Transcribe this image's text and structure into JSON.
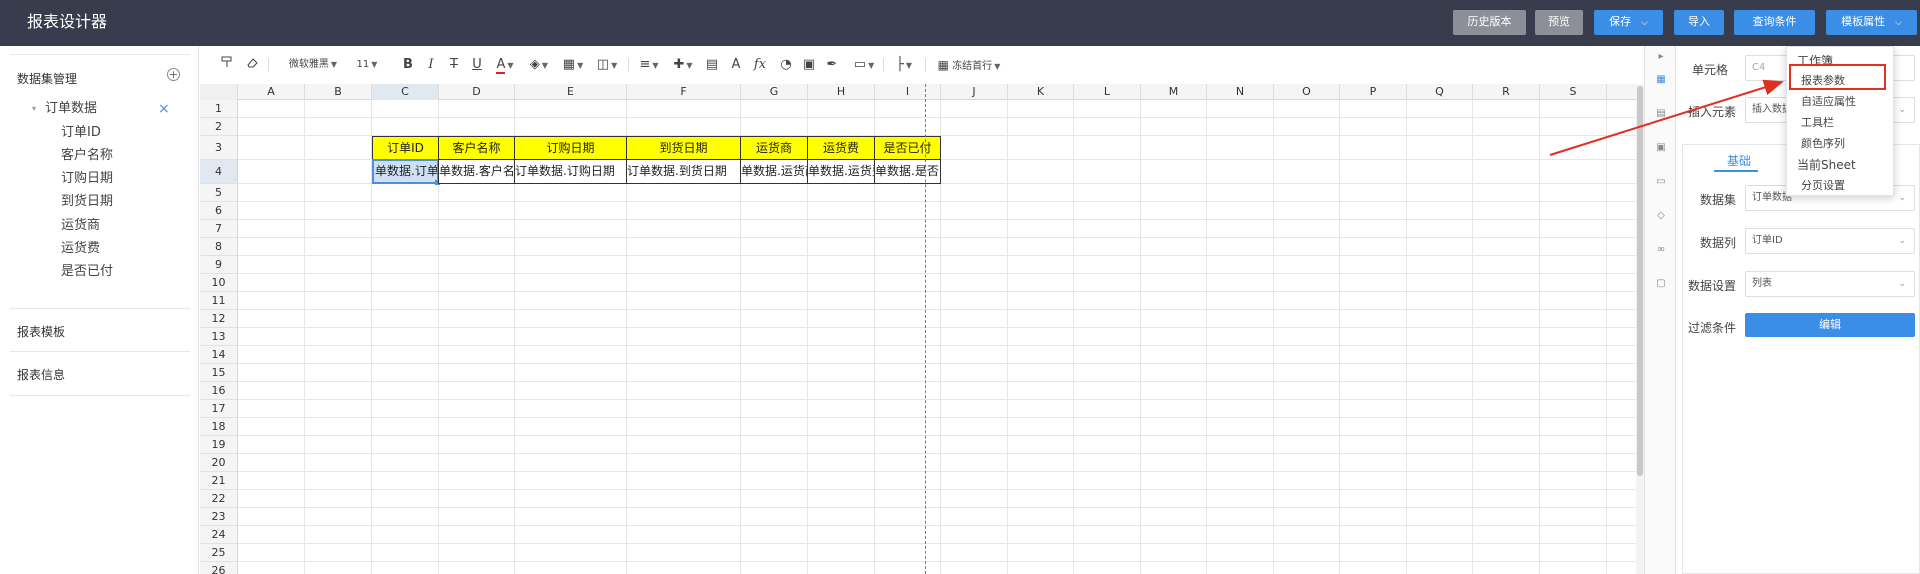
{
  "app": {
    "title": "报表设计器"
  },
  "topbar": {
    "buttons": {
      "history": "历史版本",
      "preview": "预览",
      "save": "保存",
      "import": "导入",
      "query": "查询条件",
      "template": "模板属性"
    }
  },
  "sidebar": {
    "dataset_title": "数据集管理",
    "dataset_name": "订单数据",
    "fields": [
      "订单ID",
      "客户名称",
      "订购日期",
      "到货日期",
      "运货商",
      "运货费",
      "是否已付"
    ],
    "template_section": "报表模板",
    "info_section": "报表信息"
  },
  "toolbar": {
    "font": "微软雅黑",
    "size": "11",
    "bold": "B",
    "italic": "I",
    "strike": "T",
    "underline": "U",
    "fontcolor": "A",
    "fx": "fx",
    "a2": "A",
    "freeze": "冻结首行"
  },
  "grid": {
    "columns": [
      "A",
      "B",
      "C",
      "D",
      "E",
      "F",
      "G",
      "H",
      "I",
      "J",
      "K",
      "L",
      "M",
      "N",
      "O",
      "P",
      "Q",
      "R",
      "S"
    ],
    "rows": [
      "1",
      "2",
      "3",
      "4",
      "5",
      "6",
      "7",
      "8",
      "9",
      "10",
      "11",
      "12",
      "13",
      "14",
      "15",
      "16",
      "17",
      "18",
      "19",
      "20",
      "21",
      "22",
      "23",
      "24",
      "25",
      "26"
    ],
    "header_cells": [
      "订单ID",
      "客户名称",
      "订购日期",
      "到货日期",
      "运货商",
      "运货费",
      "是否已付"
    ],
    "data_cells": [
      "单数据.订单",
      "单数据.客户名",
      "订单数据.订购日期",
      "订单数据.到货日期",
      "单数据.运货商",
      "单数据.运货费",
      "单数据.是否已付"
    ],
    "colors": {
      "header_fill": "#ffff00",
      "selection": "#4a8fe0",
      "page_break": "#e05050"
    }
  },
  "right_panel": {
    "cell_label": "单元格",
    "cell_value": "C4",
    "insert_label": "插入元素",
    "insert_value": "插入数据",
    "tab_basic": "基础",
    "dataset_label": "数据集",
    "dataset_value": "订单数据",
    "column_label": "数据列",
    "column_value": "订单ID",
    "setting_label": "数据设置",
    "setting_value": "列表",
    "filter_label": "过滤条件",
    "edit_button": "编辑"
  },
  "menu": {
    "items": [
      "工作簿",
      "报表参数",
      "自适应属性",
      "工具栏",
      "颜色序列",
      "当前Sheet",
      "分页设置"
    ],
    "highlighted": "报表参数",
    "highlight_color": "#e03020"
  }
}
